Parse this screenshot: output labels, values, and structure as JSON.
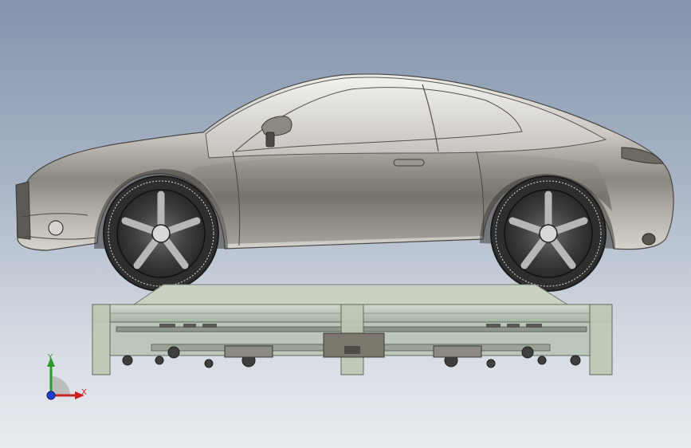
{
  "triad": {
    "x_label": "X",
    "y_label": "Y"
  },
  "colors": {
    "bg_top": "#8494ad",
    "bg_bottom": "#e9ecf0",
    "body_light": "#d9d7d2",
    "body_dark": "#6e6b66",
    "platform_glass": "#b9c7b3",
    "axis_x": "#cc2222",
    "axis_y": "#2a9a2a",
    "axis_z": "#1e3fcf"
  },
  "icons": [
    "triad-x-arrow-icon",
    "triad-y-arrow-icon",
    "triad-z-dot-icon"
  ]
}
